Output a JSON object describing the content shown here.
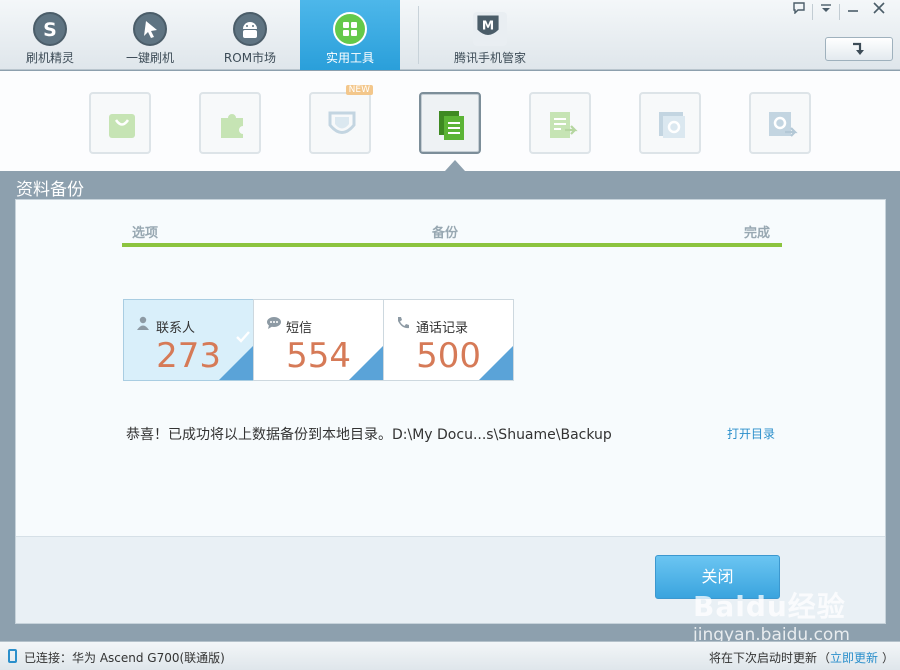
{
  "nav": {
    "items": [
      {
        "label": "刷机精灵",
        "icon": "s-logo-icon"
      },
      {
        "label": "一键刷机",
        "icon": "cursor-arrow-icon"
      },
      {
        "label": "ROM市场",
        "icon": "android-icon"
      },
      {
        "label": "实用工具",
        "icon": "grid-tiles-icon"
      },
      {
        "label": "腾讯手机管家",
        "icon": "m-shield-icon"
      }
    ],
    "active_index": 3
  },
  "window_controls": [
    "feedback-icon",
    "menu-down-icon",
    "minimize-icon",
    "close-icon"
  ],
  "tools": {
    "icons": [
      "shopping-bag-icon",
      "puzzle-icon",
      "shield-icon",
      "document-stack-icon",
      "export-document-icon",
      "settings-window-icon",
      "settings-export-icon"
    ],
    "new_badge": "NEW",
    "active_index": 3
  },
  "section": {
    "title": "资料备份",
    "steps": [
      "选项",
      "备份",
      "完成"
    ],
    "progress": 1.0
  },
  "cards": [
    {
      "label": "联系人",
      "value": "273",
      "icon": "person-icon",
      "selected": true
    },
    {
      "label": "短信",
      "value": "554",
      "icon": "chat-bubble-icon",
      "selected": false
    },
    {
      "label": "通话记录",
      "value": "500",
      "icon": "phone-icon",
      "selected": false
    }
  ],
  "message": "恭喜！已成功将以上数据备份到本地目录。D:\\My Docu...s\\Shuame\\Backup",
  "open_dir_label": "打开目录",
  "close_label": "关闭",
  "status": {
    "connected": "已连接：华为 Ascend G700(联通版)",
    "update_text": "将在下次启动时更新",
    "paren_open": "（",
    "update_now": "立即更新",
    "paren_close": "）"
  },
  "watermark": {
    "brand": "Baidu经验",
    "sub": "jingyan.baidu.com"
  },
  "colors": {
    "accent": "#2a9fda",
    "progress": "#8cc43f",
    "count": "#d67a57",
    "link": "#2b8fcb"
  }
}
